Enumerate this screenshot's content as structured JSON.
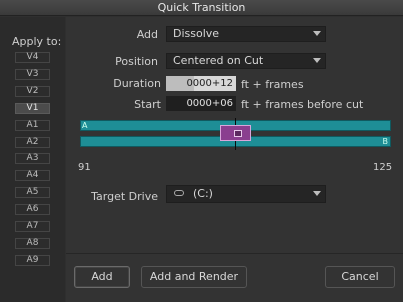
{
  "window": {
    "title": "Quick Transition"
  },
  "apply_to": {
    "label": "Apply to:",
    "tracks": [
      "V4",
      "V3",
      "V2",
      "V1",
      "A1",
      "A2",
      "A3",
      "A4",
      "A5",
      "A6",
      "A7",
      "A8",
      "A9"
    ],
    "active": [
      "V1"
    ]
  },
  "add": {
    "label": "Add",
    "value": "Dissolve"
  },
  "position": {
    "label": "Position",
    "value": "Centered on Cut"
  },
  "duration": {
    "label": "Duration",
    "value": "0000+12",
    "suffix": "ft + frames"
  },
  "start": {
    "label": "Start",
    "value": "0000+06",
    "suffix": "ft + frames before cut"
  },
  "timeline": {
    "clip_a": "A",
    "clip_b": "B",
    "start_frame": "91",
    "end_frame": "125"
  },
  "target_drive": {
    "label": "Target Drive",
    "value": "(C:)"
  },
  "buttons": {
    "add": "Add",
    "add_and_render": "Add and Render",
    "cancel": "Cancel"
  },
  "colors": {
    "clip_bar": "#1e8e96",
    "transition": "#8a3f8f"
  }
}
